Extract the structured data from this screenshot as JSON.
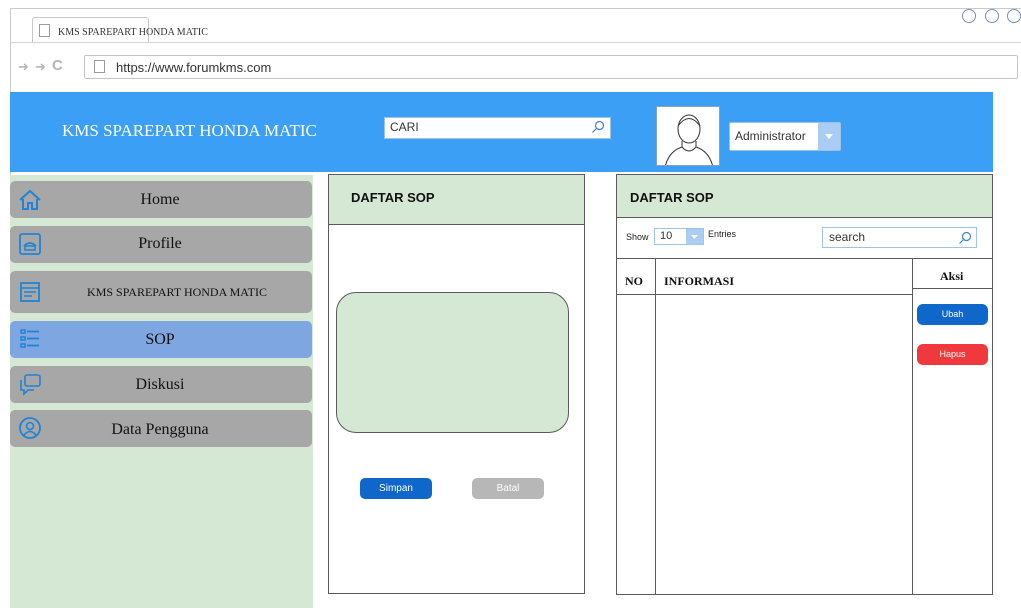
{
  "browser": {
    "tab_title": "KMS SPAREPART HONDA MATIC",
    "url": "https://www.forumkms.com"
  },
  "header": {
    "app_title": "KMS SPAREPART HONDA MATIC",
    "search_placeholder": "CARI",
    "user_name": "Administrator"
  },
  "sidebar": {
    "items": [
      {
        "label": "Home",
        "icon": "home-icon"
      },
      {
        "label": "Profile",
        "icon": "phone-icon"
      },
      {
        "label": "KMS SPAREPART HONDA MATIC",
        "icon": "document-icon"
      },
      {
        "label": "SOP",
        "icon": "list-icon",
        "active": true
      },
      {
        "label": "Diskusi",
        "icon": "chat-icon"
      },
      {
        "label": "Data Pengguna",
        "icon": "user-icon"
      }
    ]
  },
  "form_panel": {
    "title": "DAFTAR SOP",
    "save_label": "Simpan",
    "cancel_label": "Batal"
  },
  "list_panel": {
    "title": "DAFTAR SOP",
    "show_label": "Show",
    "entries_value": "10",
    "entries_label": "Entries",
    "search_placeholder": "search",
    "columns": [
      "NO",
      "INFORMASI",
      "Aksi"
    ],
    "edit_label": "Ubah",
    "delete_label": "Hapus"
  },
  "colors": {
    "header_bg": "#3ba0f5",
    "sidebar_bg": "#d5e8d4",
    "active_item": "#7ea6e0",
    "primary_button": "#0f67c9",
    "danger_button": "#f0393d"
  }
}
